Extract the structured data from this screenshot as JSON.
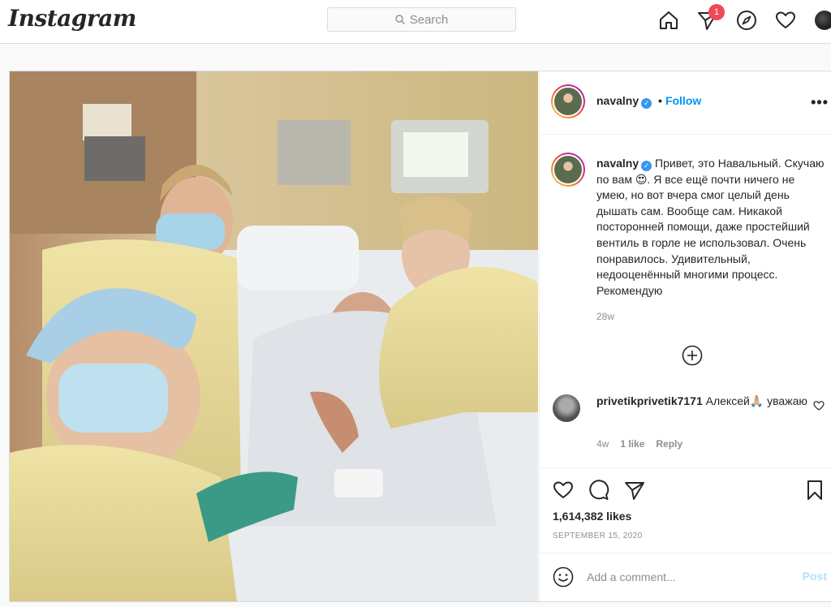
{
  "app": {
    "logo": "Instagram"
  },
  "nav": {
    "search_placeholder": "Search",
    "activity_badge": "1"
  },
  "post": {
    "author": "navalny",
    "follow_label": "Follow",
    "more_label": "•••",
    "caption_author": "navalny",
    "caption_text": "Привет, это Навальный. Скучаю по вам 😍. Я все ещё почти ничего не умею, но вот вчера смог целый день дышать сам. Вообще сам. Никакой посторонней помощи, даже простейший вентиль в горле не использовал. Очень понравилось. Удивительный, недооценённый многими процесс. Рекомендую",
    "caption_age": "28w",
    "comment": {
      "author": "privetikprivetik7171",
      "text": "Алексей🙏🏼 уважаю",
      "age": "4w",
      "likes": "1 like",
      "reply_label": "Reply"
    },
    "likes_count": "1,614,382 likes",
    "date": "SEPTEMBER 15, 2020",
    "add_comment_placeholder": "Add a comment...",
    "post_label": "Post"
  }
}
